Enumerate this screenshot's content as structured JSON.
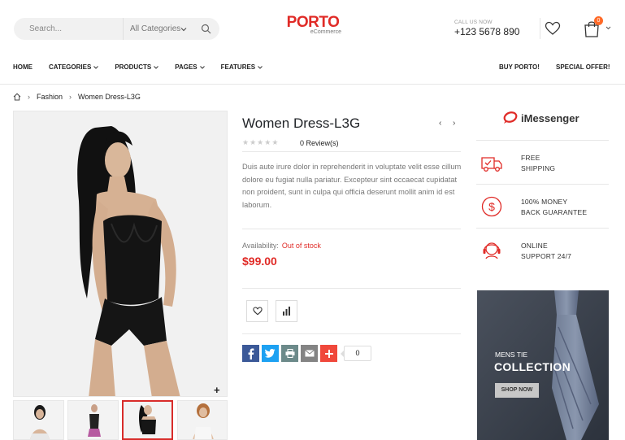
{
  "search": {
    "placeholder": "Search...",
    "category": "All Categories"
  },
  "logo": {
    "main": "PORTO",
    "sub": "eCommerce"
  },
  "contact": {
    "label": "CALL US NOW",
    "phone": "+123 5678 890"
  },
  "cart": {
    "count": "0"
  },
  "nav": {
    "items": [
      {
        "label": "HOME"
      },
      {
        "label": "CATEGORIES"
      },
      {
        "label": "PRODUCTS"
      },
      {
        "label": "PAGES"
      },
      {
        "label": "FEATURES"
      }
    ],
    "right": [
      {
        "label": "BUY PORTO!"
      },
      {
        "label": "SPECIAL OFFER!"
      }
    ]
  },
  "breadcrumb": {
    "items": [
      {
        "label": "Fashion"
      },
      {
        "label": "Women Dress-L3G"
      }
    ]
  },
  "product": {
    "title": "Women Dress-L3G",
    "reviews": "0 Review(s)",
    "description": "Duis aute irure dolor in reprehenderit in voluptate velit esse cillum dolore eu fugiat nulla pariatur. Excepteur sint occaecat cupidatat non proident, sunt in culpa qui officia deserunt mollit anim id est laborum.",
    "availability_label": "Availability:",
    "availability_value": "Out of stock",
    "price": "$99.00",
    "rating": 0,
    "share_count": "0"
  },
  "sidebar": {
    "brand": "iMessenger",
    "features": [
      {
        "line1": "FREE",
        "line2": "SHIPPING",
        "icon": "truck-icon"
      },
      {
        "line1": "100% MONEY",
        "line2": "BACK GUARANTEE",
        "icon": "dollar-icon"
      },
      {
        "line1": "ONLINE",
        "line2": "SUPPORT 24/7",
        "icon": "headset-icon"
      }
    ],
    "banner": {
      "line1": "MENS TIE",
      "line2": "COLLECTION",
      "button": "SHOP NOW"
    }
  },
  "colors": {
    "accent": "#e02b27",
    "badge": "#ff6a28",
    "facebook": "#3b5998",
    "twitter": "#1da1f2",
    "print": "#6c8a8a",
    "email": "#848484",
    "plus": "#f0483b"
  }
}
